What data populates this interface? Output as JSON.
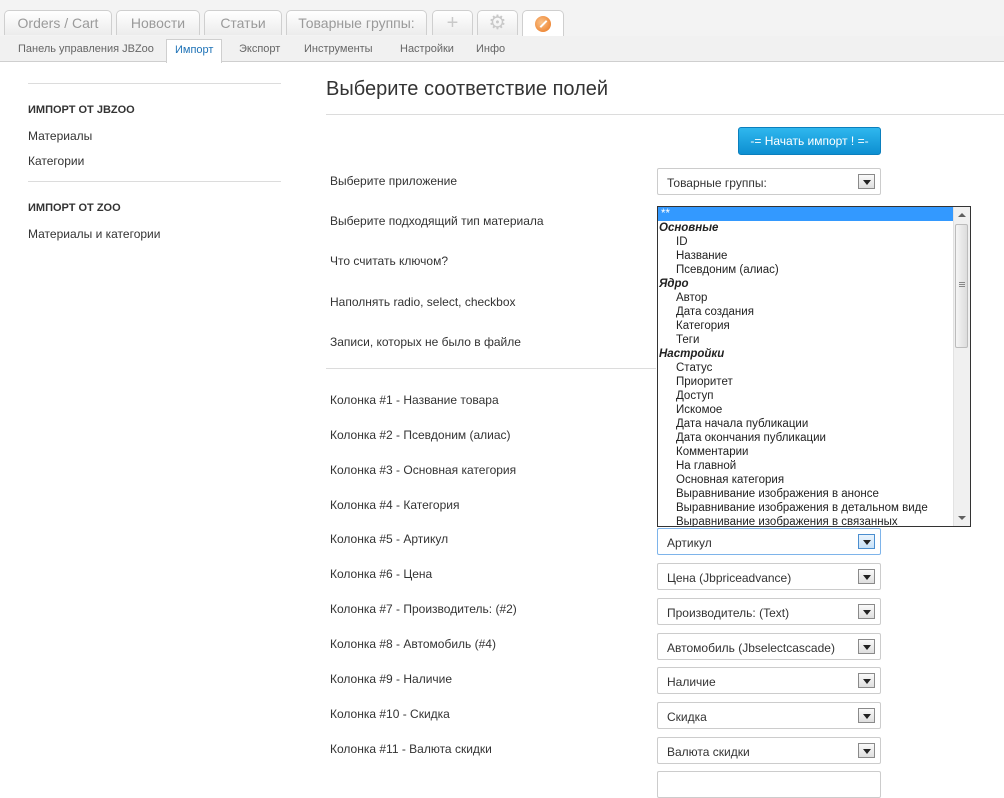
{
  "app_tabs": [
    {
      "label": "Orders / Cart"
    },
    {
      "label": "Новости"
    },
    {
      "label": "Статьи"
    },
    {
      "label": "Товарные группы:"
    }
  ],
  "app_tab_icons": {
    "add": "+",
    "settings": "⚙",
    "zoo": "zoo-logo-icon"
  },
  "sub_tabs": [
    {
      "label": "Панель управления JBZoo"
    },
    {
      "label": "Импорт",
      "active": true
    },
    {
      "label": "Экспорт"
    },
    {
      "label": "Инструменты"
    },
    {
      "label": "Настройки"
    },
    {
      "label": "Инфо"
    }
  ],
  "sidebar": {
    "section1_title": "ИМПОРТ ОТ JBZOO",
    "section1_items": [
      "Материалы",
      "Категории"
    ],
    "section2_title": "ИМПОРТ ОТ ZOO",
    "section2_items": [
      "Материалы и категории"
    ]
  },
  "main": {
    "title": "Выберите соответствие полей",
    "start_button": "-= Начать импорт ! =-",
    "settings": [
      {
        "label": "Выберите приложение",
        "value": "Товарные группы:"
      },
      {
        "label": "Выберите подходящий тип материала"
      },
      {
        "label": "Что считать ключом?"
      },
      {
        "label": "Наполнять radio, select, checkbox"
      },
      {
        "label": "Записи, которых не было в файле"
      }
    ],
    "columns": [
      {
        "label": "Колонка #1 - Название товара"
      },
      {
        "label": "Колонка #2 - Псевдоним (алиас)"
      },
      {
        "label": "Колонка #3 - Основная категория"
      },
      {
        "label": "Колонка #4 - Категория"
      },
      {
        "label": "Колонка #5 - Артикул",
        "value": "Артикул"
      },
      {
        "label": "Колонка #6 - Цена",
        "value": "Цена (Jbpriceadvance)"
      },
      {
        "label": "Колонка #7 - Производитель: (#2)",
        "value": "Производитель: (Text)"
      },
      {
        "label": "Колонка #8 - Автомобиль (#4)",
        "value": "Автомобиль (Jbselectcascade)"
      },
      {
        "label": "Колонка #9 - Наличие",
        "value": "Наличие"
      },
      {
        "label": "Колонка #10 - Скидка",
        "value": "Скидка"
      },
      {
        "label": "Колонка #11 - Валюта скидки",
        "value": "Валюта скидки"
      }
    ]
  },
  "dropdown": {
    "options": [
      {
        "label": "**",
        "type": "selected"
      },
      {
        "label": "Основные",
        "type": "group"
      },
      {
        "label": "ID"
      },
      {
        "label": "Название"
      },
      {
        "label": "Псевдоним (алиас)"
      },
      {
        "label": "Ядро",
        "type": "group"
      },
      {
        "label": "Автор"
      },
      {
        "label": "Дата создания"
      },
      {
        "label": "Категория"
      },
      {
        "label": "Теги"
      },
      {
        "label": "Настройки",
        "type": "group"
      },
      {
        "label": "Статус"
      },
      {
        "label": "Приоритет"
      },
      {
        "label": "Доступ"
      },
      {
        "label": "Искомое"
      },
      {
        "label": "Дата начала публикации"
      },
      {
        "label": "Дата окончания публикации"
      },
      {
        "label": "Комментарии"
      },
      {
        "label": "На главной"
      },
      {
        "label": "Основная категория"
      },
      {
        "label": "Выравнивание изображения в анонсе"
      },
      {
        "label": "Выравнивание изображения в детальном виде"
      },
      {
        "label": "Выравнивание изображения в связанных"
      }
    ]
  },
  "colors": {
    "accent": "#1f73b7",
    "button": "#0d8fd1",
    "selection": "#3399ff"
  }
}
